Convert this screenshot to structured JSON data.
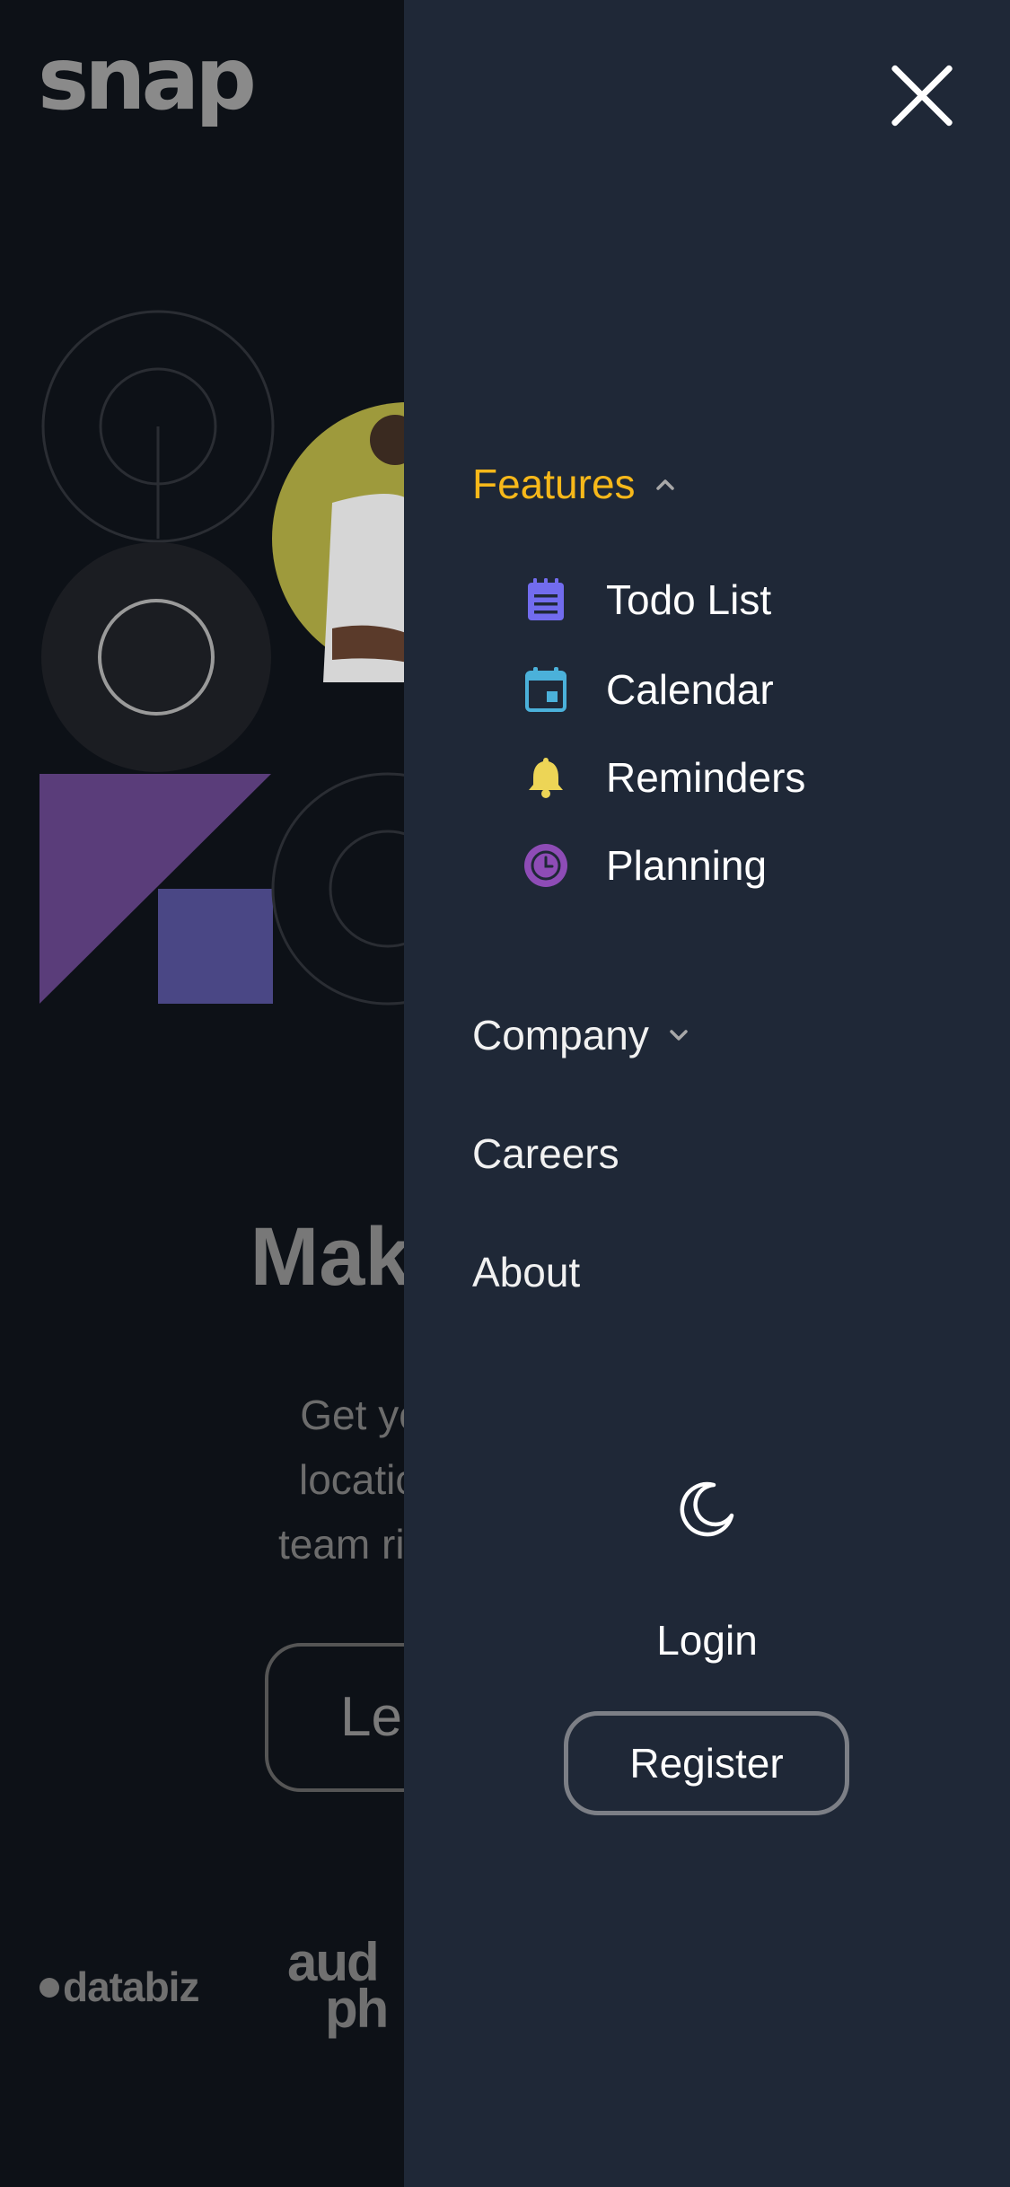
{
  "brand": {
    "name": "snap"
  },
  "hero": {
    "headline": "Make re",
    "subtext_lines": [
      "Get your team",
      "location. Strea",
      "team rituals, and"
    ],
    "cta_label": "Le"
  },
  "clients": {
    "logo_1": "databiz",
    "logo_2_line_1": "aud",
    "logo_2_line_2": "ph"
  },
  "nav": {
    "features": {
      "label": "Features",
      "expanded": true
    },
    "features_items": [
      {
        "label": "Todo List",
        "icon": "todo-list-icon",
        "color": "#726cee"
      },
      {
        "label": "Calendar",
        "icon": "calendar-icon",
        "color": "#4bb1da"
      },
      {
        "label": "Reminders",
        "icon": "bell-icon",
        "color": "#edd556"
      },
      {
        "label": "Planning",
        "icon": "clock-icon",
        "color": "#8e4cb6"
      }
    ],
    "company": {
      "label": "Company",
      "expanded": false
    },
    "careers": "Careers",
    "about": "About"
  },
  "actions": {
    "theme_icon": "moon-icon",
    "login": "Login",
    "register": "Register"
  },
  "colors": {
    "panel_bg": "#1f2837",
    "page_bg": "#0d1117",
    "accent": "#f7b81a"
  }
}
